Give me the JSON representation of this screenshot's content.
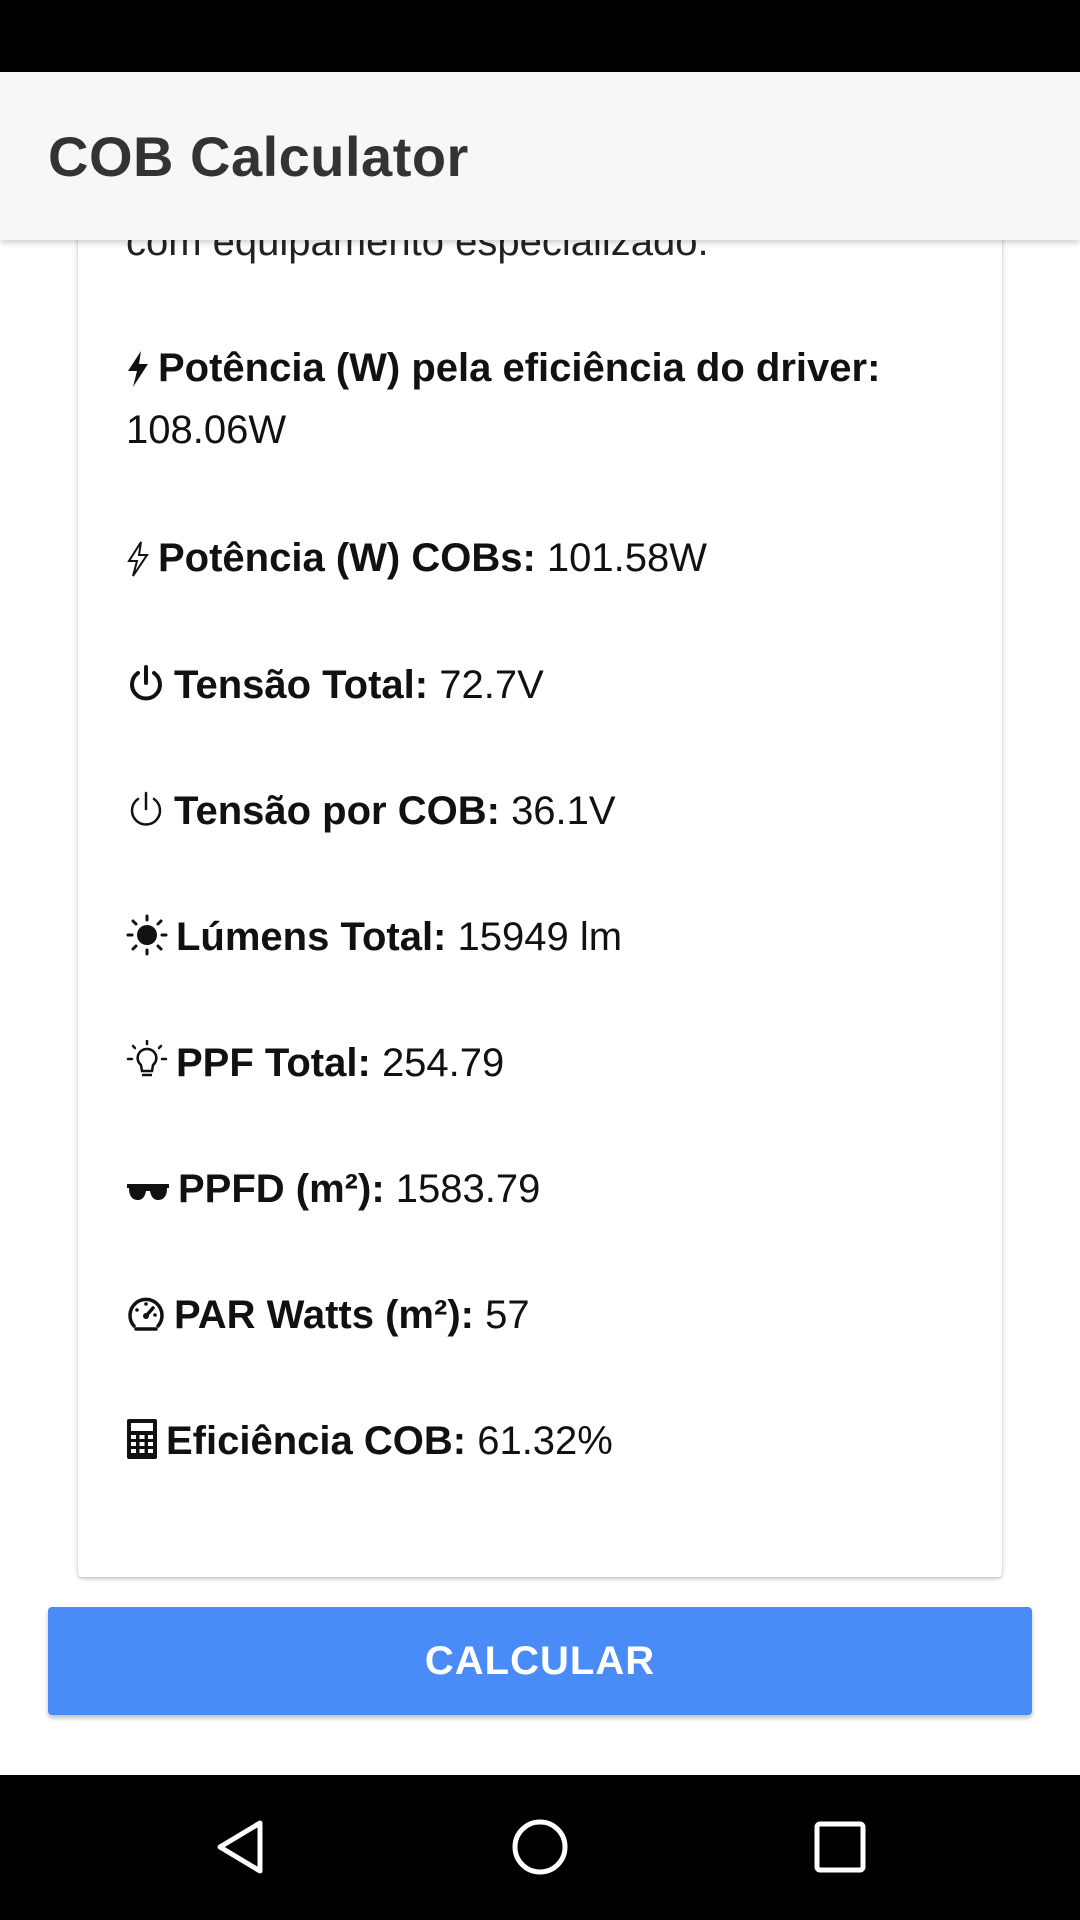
{
  "app": {
    "title": "COB Calculator"
  },
  "intro_text": "com equipamento especializado.",
  "results": [
    {
      "icon": "bolt-icon",
      "label": "Potência (W) pela eficiência do driver:",
      "value": "108.06W"
    },
    {
      "icon": "bolt-outline-icon",
      "label": "Potência (W) COBs:",
      "value": "101.58W"
    },
    {
      "icon": "power-icon",
      "label": "Tensão Total:",
      "value": "72.7V"
    },
    {
      "icon": "power-outline-icon",
      "label": "Tensão por COB:",
      "value": "36.1V"
    },
    {
      "icon": "sun-icon",
      "label": "Lúmens Total:",
      "value": "15949 lm"
    },
    {
      "icon": "lightbulb-icon",
      "label": "PPF Total:",
      "value": "254.79"
    },
    {
      "icon": "sunglasses-icon",
      "label": "PPFD (m²):",
      "value": "1583.79"
    },
    {
      "icon": "gauge-icon",
      "label": "PAR Watts (m²):",
      "value": "57"
    },
    {
      "icon": "calculator-icon",
      "label": "Eficiência COB:",
      "value": "61.32%"
    }
  ],
  "button": {
    "label": "CALCULAR"
  },
  "nav": {
    "back": "back-icon",
    "home": "home-icon",
    "recents": "recents-icon"
  },
  "colors": {
    "accent": "#4a8cf7",
    "app_bar": "#f7f7f7",
    "system_bars": "#000000"
  }
}
